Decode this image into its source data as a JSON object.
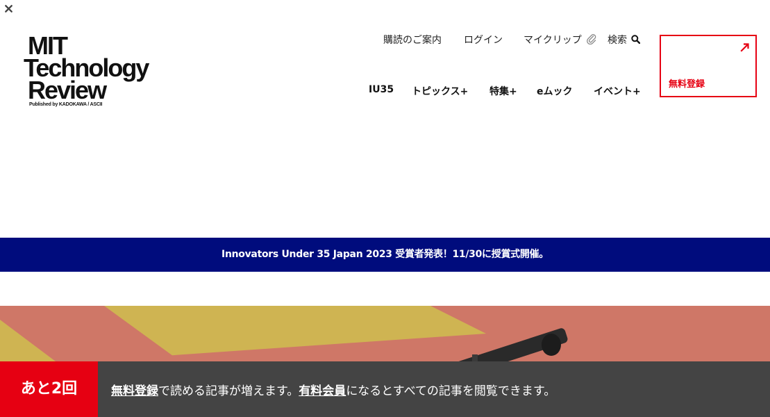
{
  "logo": {
    "line1": "MIT",
    "line2": "Technology",
    "line3": "Review",
    "line4": "Published by KADOKAWA / ASCII"
  },
  "utility_nav": [
    {
      "label": "購読のご案内"
    },
    {
      "label": "ログイン"
    },
    {
      "label": "マイクリップ",
      "icon": "paperclip-icon"
    },
    {
      "label": "検索",
      "icon": "search-icon"
    }
  ],
  "main_nav": [
    {
      "label": "IU35"
    },
    {
      "label": "トピックス+"
    },
    {
      "label": "特集+"
    },
    {
      "label": "eムック"
    },
    {
      "label": "イベント+"
    }
  ],
  "register": {
    "label": "無料登録",
    "icon": "arrow-up-right-icon"
  },
  "banner": {
    "text": "Innovators Under 35 Japan 2023 受賞者発表！11/30に授賞式開催。"
  },
  "paywall": {
    "count": "あと2回",
    "link1": "無料登録",
    "text1": "で読める記事が増えます。",
    "link2": "有料会員",
    "text2": "になるとすべての記事を閲覧できます。",
    "close_icon": "close-icon"
  },
  "colors": {
    "accent": "#e60012",
    "banner_bg": "#000c7d",
    "paywall_bg": "#444444",
    "hero_salmon": "#cf7767",
    "hero_yellow": "#cfb452"
  }
}
